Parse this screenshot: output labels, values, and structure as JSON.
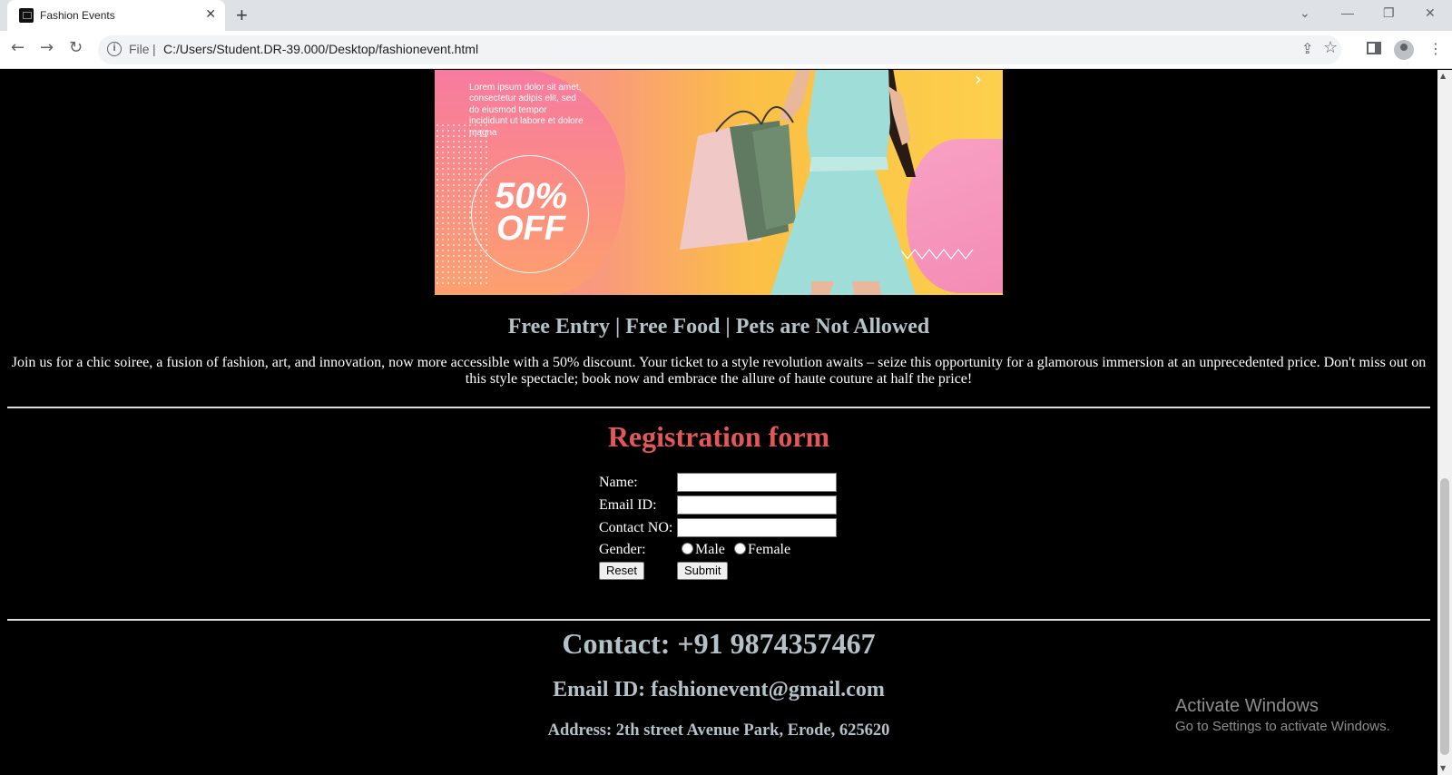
{
  "browser": {
    "tab_title": "Fashion Events",
    "tab_close": "✕",
    "new_tab": "+",
    "omnibox_scheme": "File",
    "omnibox_separator": "|",
    "url": "C:/Users/Student.DR-39.000/Desktop/fashionevent.html"
  },
  "banner": {
    "text": "Lorem ipsum dolor sit amet, consectetur adipis elit, sed do eiusmod tempor incididunt ut labore et dolore magna",
    "discount_value": "50%",
    "discount_label": "OFF",
    "colors": {
      "pink": "#f8889a",
      "yellow": "#fcd04c",
      "dress": "#9fded8"
    }
  },
  "info": {
    "heading": "Free Entry | Free Food | Pets are Not Allowed",
    "paragraph": "Join us for a chic soiree, a fusion of fashion, art, and innovation, now more accessible with a 50% discount. Your ticket to a style revolution awaits – seize this opportunity for a glamorous immersion at an unprecedented price. Don't miss out on this style spectacle; book now and embrace the allure of haute couture at half the price!"
  },
  "form": {
    "title": "Registration form",
    "name_label": "Name:",
    "email_label": "Email ID:",
    "contact_label": "Contact NO:",
    "gender_label": "Gender:",
    "male_label": "Male",
    "female_label": "Female",
    "name_value": "",
    "email_value": "",
    "contact_value": "",
    "reset_label": "Reset",
    "submit_label": "Submit"
  },
  "footer": {
    "contact": "Contact: +91 9874357467",
    "email": "Email ID: fashionevent@gmail.com",
    "address": "Address: 2th street Avenue Park, Erode, 625620"
  },
  "watermark": {
    "title": "Activate Windows",
    "subtitle": "Go to Settings to activate Windows."
  },
  "theme": {
    "heading_color": "#b4c2c7",
    "form_title_color": "#e25757",
    "background": "#000000"
  }
}
